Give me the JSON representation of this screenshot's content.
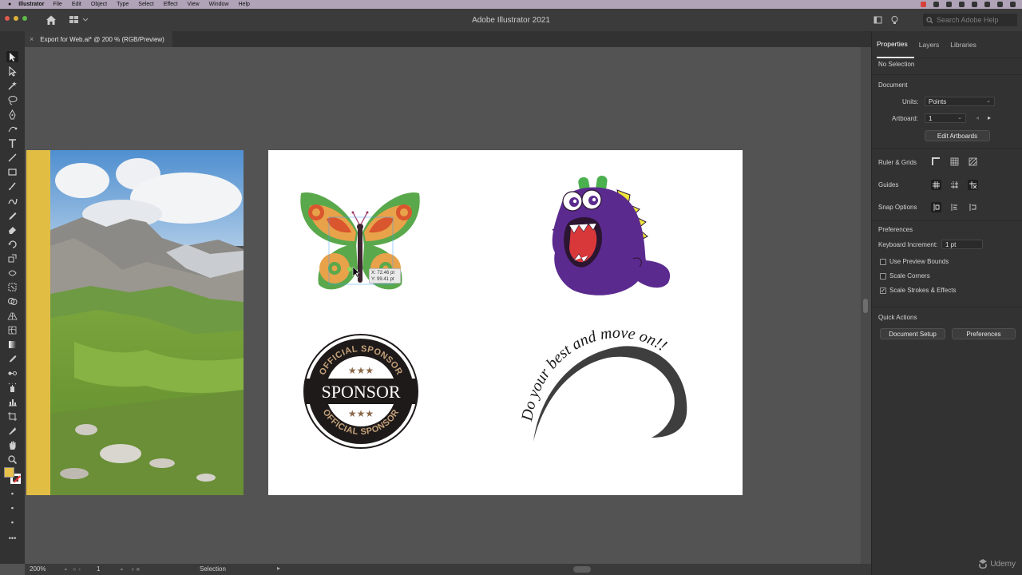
{
  "menubar": {
    "app": "Illustrator",
    "items": [
      "File",
      "Edit",
      "Object",
      "Type",
      "Select",
      "Effect",
      "View",
      "Window",
      "Help"
    ]
  },
  "titlebar": {
    "title": "Adobe Illustrator 2021",
    "search_placeholder": "Search Adobe Help"
  },
  "document": {
    "tab_label": "Export for Web.ai* @ 200 % (RGB/Preview)"
  },
  "tools": [
    "selection-tool",
    "direct-selection-tool",
    "magic-wand-tool",
    "lasso-tool",
    "pen-tool",
    "curvature-tool",
    "type-tool",
    "line-tool",
    "rectangle-tool",
    "paintbrush-tool",
    "shaper-tool",
    "pencil-tool",
    "eraser-tool",
    "rotate-tool",
    "scale-tool",
    "width-tool",
    "free-transform-tool",
    "shape-builder-tool",
    "perspective-grid-tool",
    "mesh-tool",
    "gradient-tool",
    "eyedropper-tool",
    "blend-tool",
    "symbol-sprayer-tool",
    "column-graph-tool",
    "artboard-tool",
    "slice-tool",
    "hand-tool",
    "zoom-tool"
  ],
  "artwork": {
    "tooltip_x": "X: 72.46 pt",
    "tooltip_y": "Y: 99.41 pt",
    "badge_top": "OFFICIAL SPONSOR",
    "badge_main": "SPONSOR",
    "badge_bottom": "OFFICIAL SPONSOR",
    "curved_text": "Do your best and move on!!"
  },
  "status": {
    "zoom": "200%",
    "artboard_num": "1",
    "tool": "Selection"
  },
  "panel": {
    "tabs": [
      "Properties",
      "Layers",
      "Libraries"
    ],
    "no_selection": "No Selection",
    "document_header": "Document",
    "units_label": "Units:",
    "units_value": "Points",
    "artboard_label": "Artboard:",
    "artboard_value": "1",
    "edit_artboards": "Edit Artboards",
    "ruler_grids": "Ruler & Grids",
    "guides": "Guides",
    "snap_options": "Snap Options",
    "preferences_header": "Preferences",
    "keyboard_increment_label": "Keyboard Increment:",
    "keyboard_increment_value": "1 pt",
    "use_preview_bounds": "Use Preview Bounds",
    "scale_corners": "Scale Corners",
    "scale_strokes": "Scale Strokes & Effects",
    "quick_actions": "Quick Actions",
    "document_setup": "Document Setup",
    "preferences_button": "Preferences"
  },
  "watermark": "Udemy",
  "colors": {
    "fill_swatch": "#e8c24a",
    "accent_yellow": "#e8c24a",
    "monster_purple": "#5b2a8e",
    "butterfly_orange": "#e8a24a",
    "butterfly_green": "#5aa84c"
  }
}
